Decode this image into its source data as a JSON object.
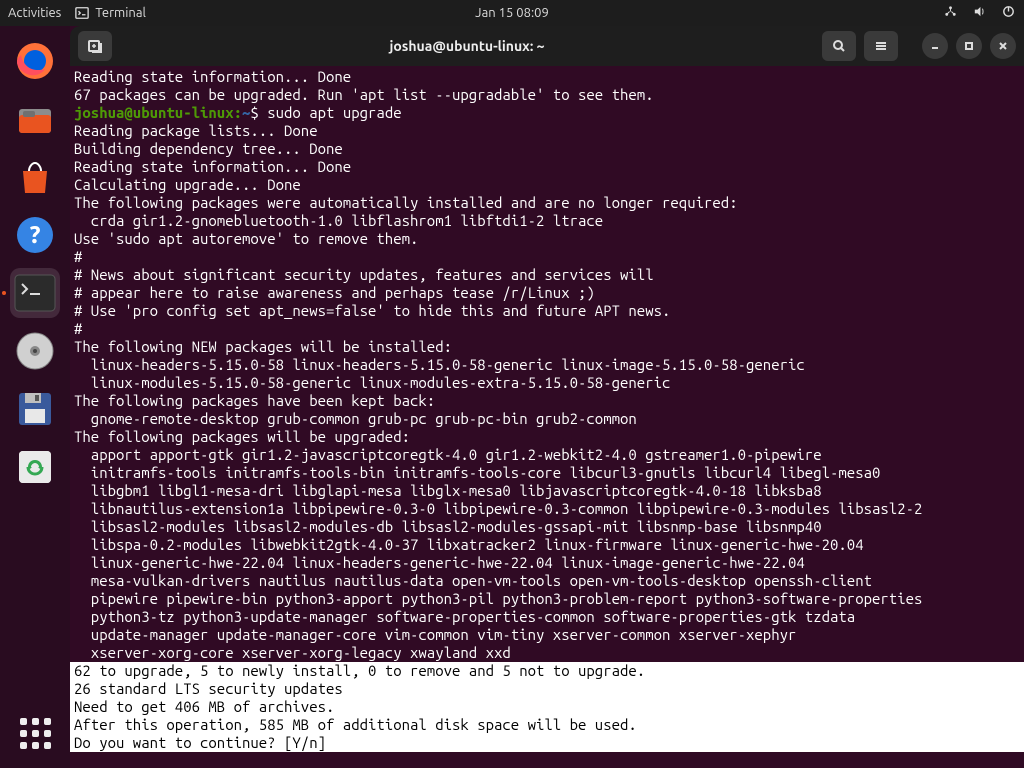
{
  "topbar": {
    "activities": "Activities",
    "appname": "Terminal",
    "clock": "Jan 15  08:09"
  },
  "window": {
    "title": "joshua@ubuntu-linux: ~"
  },
  "prompt": {
    "user": "joshua@ubuntu-linux",
    "path": "~",
    "command": "sudo apt upgrade"
  },
  "lines": {
    "l1": "Reading state information... Done",
    "l2": "67 packages can be upgraded. Run 'apt list --upgradable' to see them.",
    "l3": "Reading package lists... Done",
    "l4": "Building dependency tree... Done",
    "l5": "Reading state information... Done",
    "l6": "Calculating upgrade... Done",
    "l7": "The following packages were automatically installed and are no longer required:",
    "l8": "  crda gir1.2-gnomebluetooth-1.0 libflashrom1 libftdi1-2 ltrace",
    "l9": "Use 'sudo apt autoremove' to remove them.",
    "l10": "#",
    "l11": "# News about significant security updates, features and services will",
    "l12": "# appear here to raise awareness and perhaps tease /r/Linux ;)",
    "l13": "# Use 'pro config set apt_news=false' to hide this and future APT news.",
    "l14": "#",
    "l15": "The following NEW packages will be installed:",
    "l16": "  linux-headers-5.15.0-58 linux-headers-5.15.0-58-generic linux-image-5.15.0-58-generic",
    "l17": "  linux-modules-5.15.0-58-generic linux-modules-extra-5.15.0-58-generic",
    "l18": "The following packages have been kept back:",
    "l19": "  gnome-remote-desktop grub-common grub-pc grub-pc-bin grub2-common",
    "l20": "The following packages will be upgraded:",
    "l21": "  apport apport-gtk gir1.2-javascriptcoregtk-4.0 gir1.2-webkit2-4.0 gstreamer1.0-pipewire",
    "l22": "  initramfs-tools initramfs-tools-bin initramfs-tools-core libcurl3-gnutls libcurl4 libegl-mesa0",
    "l23": "  libgbm1 libgl1-mesa-dri libglapi-mesa libglx-mesa0 libjavascriptcoregtk-4.0-18 libksba8",
    "l24": "  libnautilus-extension1a libpipewire-0.3-0 libpipewire-0.3-common libpipewire-0.3-modules libsasl2-2",
    "l25": "  libsasl2-modules libsasl2-modules-db libsasl2-modules-gssapi-mit libsnmp-base libsnmp40",
    "l26": "  libspa-0.2-modules libwebkit2gtk-4.0-37 libxatracker2 linux-firmware linux-generic-hwe-20.04",
    "l27": "  linux-generic-hwe-22.04 linux-headers-generic-hwe-22.04 linux-image-generic-hwe-22.04",
    "l28": "  mesa-vulkan-drivers nautilus nautilus-data open-vm-tools open-vm-tools-desktop openssh-client",
    "l29": "  pipewire pipewire-bin python3-apport python3-pil python3-problem-report python3-software-properties",
    "l30": "  python3-tz python3-update-manager software-properties-common software-properties-gtk tzdata",
    "l31": "  update-manager update-manager-core vim-common vim-tiny xserver-common xserver-xephyr",
    "l32": "  xserver-xorg-core xserver-xorg-legacy xwayland xxd",
    "h1": "62 to upgrade, 5 to newly install, 0 to remove and 5 not to upgrade.",
    "h2": "26 standard LTS security updates",
    "h3": "Need to get 406 MB of archives.",
    "h4": "After this operation, 585 MB of additional disk space will be used.",
    "h5": "Do you want to continue? [Y/n] "
  }
}
